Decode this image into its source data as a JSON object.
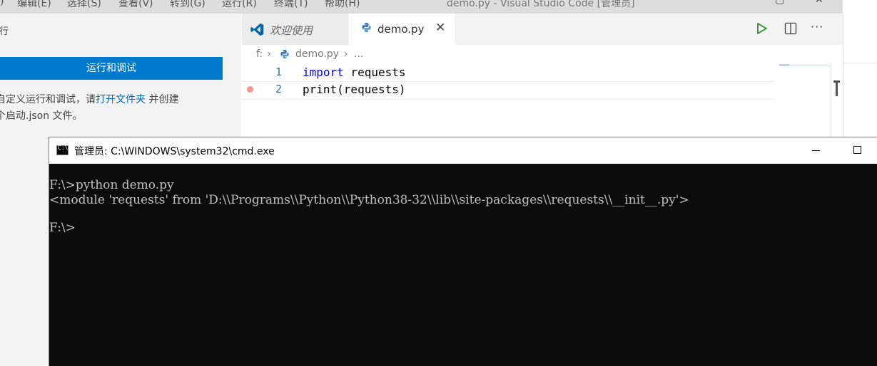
{
  "vscode": {
    "menu": [
      "编辑(E)",
      "选择(S)",
      "查看(V)",
      "转到(G)",
      "运行(R)",
      "终端(T)",
      "帮助(H)"
    ],
    "menu_left_fragment": ")",
    "window_title": "demo.py - Visual Studio Code [管理员]",
    "sidebar": {
      "heading": "行",
      "run_button": "运行和调试",
      "desc_part1": "自定义运行和调试，请",
      "desc_link": "打开文件夹",
      "desc_part2": " 并创建",
      "desc_line2": "个启动.json 文件。"
    },
    "tabs": [
      {
        "label": "欢迎使用",
        "icon": "vscode-logo-icon"
      },
      {
        "label": "demo.py",
        "icon": "python-icon",
        "close": "✕"
      }
    ],
    "editor_actions": [
      "run-icon",
      "split-editor-icon",
      "more-icon"
    ],
    "more_label": "···",
    "breadcrumb": {
      "drive": "f:",
      "file": "demo.py",
      "tail": "..."
    },
    "code_lines": [
      {
        "num": "1",
        "keyword": "import",
        "rest": " requests"
      },
      {
        "num": "2",
        "keyword": "",
        "rest": "print(requests)"
      }
    ],
    "colors": {
      "accent": "#007acc",
      "keyword": "#0000ff",
      "line_number": "#237893",
      "breakpoint": "#e51400"
    }
  },
  "cmd": {
    "title": "管理员: C:\\WINDOWS\\system32\\cmd.exe",
    "icon_text": "C:\\",
    "lines": [
      "F:\\>python demo.py",
      "<module 'requests' from 'D:\\\\Programs\\\\Python\\\\Python38-32\\\\lib\\\\site-packages\\\\requests\\\\__init__.py'>",
      "",
      "F:\\>"
    ]
  }
}
